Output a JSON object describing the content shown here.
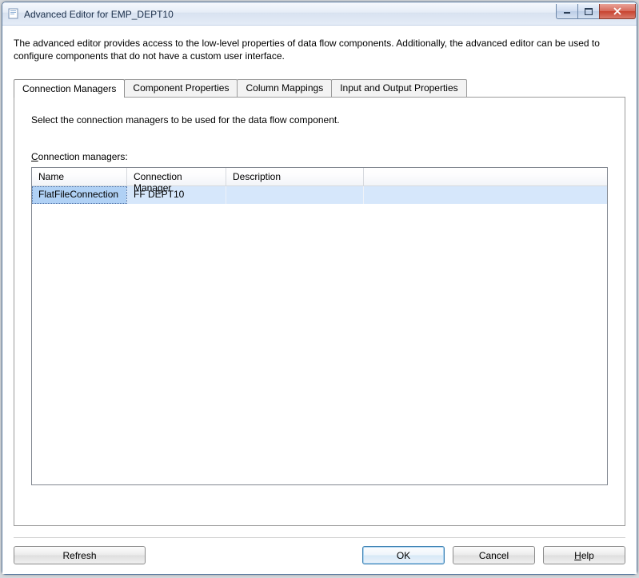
{
  "window": {
    "title": "Advanced Editor for EMP_DEPT10"
  },
  "intro": "The advanced editor provides access to the low-level properties of data flow components. Additionally, the advanced editor can be used to configure components that do not have a custom user interface.",
  "tabs": [
    {
      "label": "Connection Managers",
      "active": true
    },
    {
      "label": "Component Properties",
      "active": false
    },
    {
      "label": "Column Mappings",
      "active": false
    },
    {
      "label": "Input and Output Properties",
      "active": false
    }
  ],
  "page": {
    "description": "Select the connection managers to be used for the data flow component.",
    "section_prefix": "C",
    "section_rest": "onnection managers:",
    "columns": {
      "name": "Name",
      "manager": "Connection Manager",
      "description": "Description"
    },
    "rows": [
      {
        "name": "FlatFileConnection",
        "manager": "FF DEPT10",
        "description": ""
      }
    ]
  },
  "footer": {
    "refresh": "Refresh",
    "ok": "OK",
    "cancel": "Cancel",
    "help_prefix": "H",
    "help_rest": "elp"
  }
}
